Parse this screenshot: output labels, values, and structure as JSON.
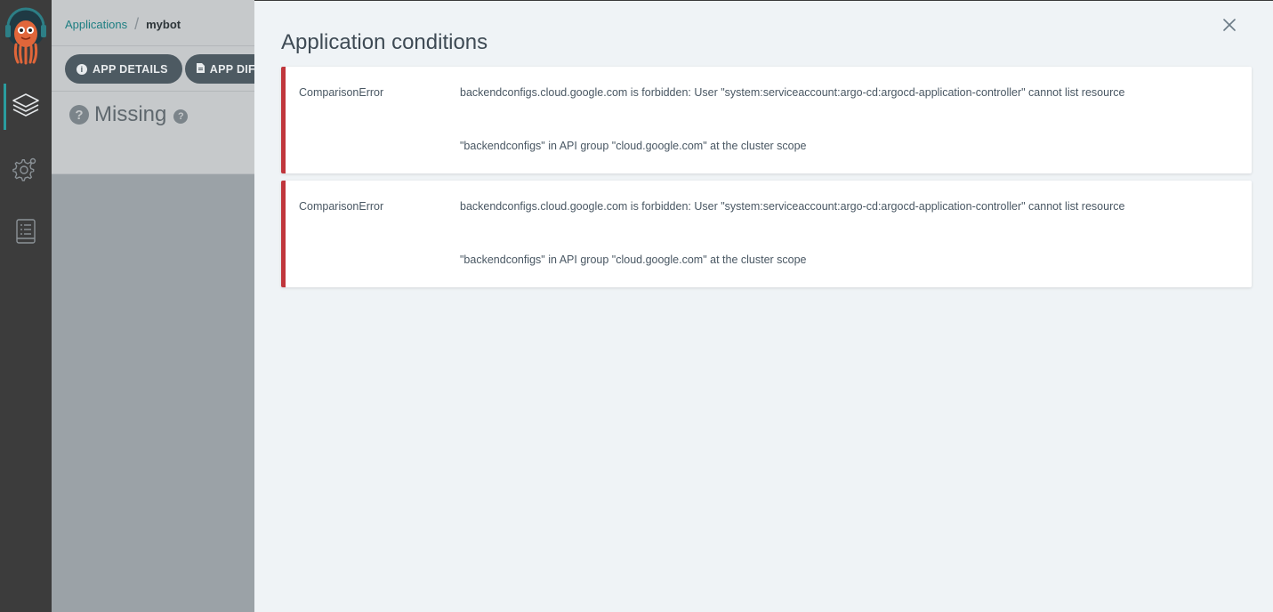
{
  "nav": {
    "items": [
      {
        "name": "applications",
        "icon": "layers-icon",
        "active": true
      },
      {
        "name": "settings",
        "icon": "gear-icon",
        "active": false
      },
      {
        "name": "user-info",
        "icon": "book-icon",
        "active": false
      }
    ]
  },
  "breadcrumb": {
    "parent": "Applications",
    "current": "mybot"
  },
  "toolbar": {
    "app_details_label": "APP DETAILS",
    "app_diff_label": "APP DIFF"
  },
  "status": {
    "health_text": "Missing"
  },
  "panel": {
    "title": "Application conditions",
    "conditions": [
      {
        "type": "ComparisonError",
        "message_line1": "backendconfigs.cloud.google.com is forbidden: User \"system:serviceaccount:argo-cd:argocd-application-controller\" cannot list resource",
        "message_line2": "\"backendconfigs\" in API group \"cloud.google.com\" at the cluster scope"
      },
      {
        "type": "ComparisonError",
        "message_line1": "backendconfigs.cloud.google.com is forbidden: User \"system:serviceaccount:argo-cd:argocd-application-controller\" cannot list resource",
        "message_line2": "\"backendconfigs\" in API group \"cloud.google.com\" at the cluster scope"
      }
    ]
  },
  "colors": {
    "accent": "#2a9d9f",
    "error": "#c0363c",
    "nav_bg": "#3c3c3c",
    "panel_bg": "#eff3f6"
  }
}
